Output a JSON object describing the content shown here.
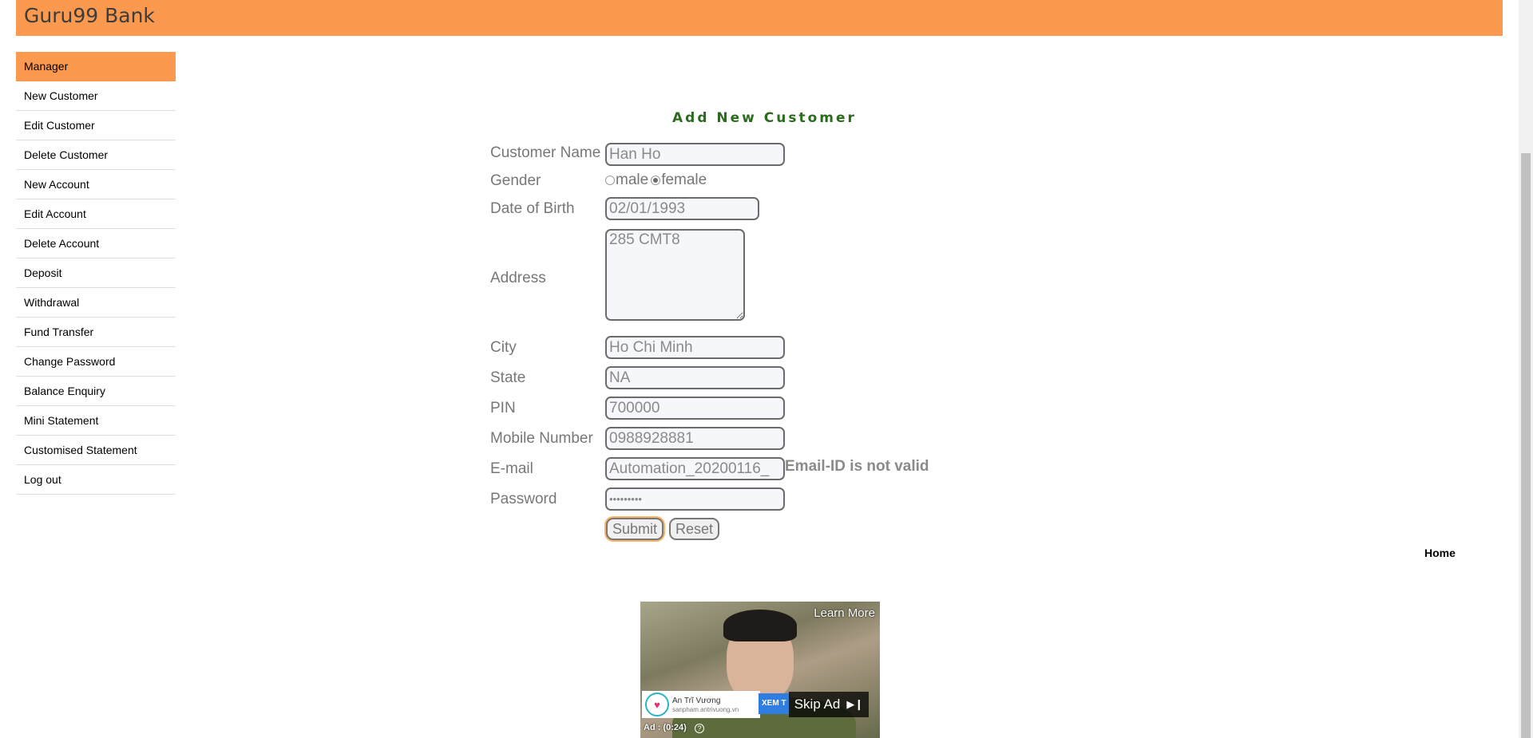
{
  "header": {
    "brand": "Guru99 Bank"
  },
  "sidebar": {
    "items": [
      {
        "label": "Manager"
      },
      {
        "label": "New Customer"
      },
      {
        "label": "Edit Customer"
      },
      {
        "label": "Delete Customer"
      },
      {
        "label": "New Account"
      },
      {
        "label": "Edit Account"
      },
      {
        "label": "Delete Account"
      },
      {
        "label": "Deposit"
      },
      {
        "label": "Withdrawal"
      },
      {
        "label": "Fund Transfer"
      },
      {
        "label": "Change Password"
      },
      {
        "label": "Balance Enquiry"
      },
      {
        "label": "Mini Statement"
      },
      {
        "label": "Customised Statement"
      },
      {
        "label": "Log out"
      }
    ]
  },
  "form": {
    "title": "Add New Customer",
    "labels": {
      "name": "Customer Name",
      "gender": "Gender",
      "dob": "Date of Birth",
      "address": "Address",
      "city": "City",
      "state": "State",
      "pin": "PIN",
      "mobile": "Mobile Number",
      "email": "E-mail",
      "password": "Password"
    },
    "values": {
      "name": "Han Ho",
      "dob": "02/01/1993",
      "address": "285 CMT8",
      "city": "Ho Chi Minh",
      "state": "NA",
      "pin": "700000",
      "mobile": "0988928881",
      "email": "Automation_20200116_",
      "password": "•••••••••"
    },
    "gender_options": {
      "male": "male",
      "female": "female",
      "selected": "female"
    },
    "email_error": "Email-ID is not valid",
    "submit_label": "Submit",
    "reset_label": "Reset"
  },
  "footer": {
    "home_link": "Home"
  },
  "ad": {
    "learn_more": "Learn More",
    "advertiser": "An Trĩ Vương",
    "advertiser_url": "sanpham.antrivuong.vn",
    "cta": "XEM T",
    "skip": "Skip Ad",
    "timer": "Ad : (0:24)",
    "help": "?"
  }
}
